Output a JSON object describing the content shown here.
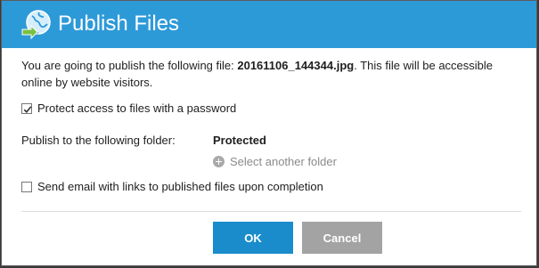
{
  "dialog": {
    "title": "Publish Files",
    "title_icon": "publish-globe-arrow-icon"
  },
  "intro": {
    "prefix": "You are going to publish the following file: ",
    "filename": "20161106_144344.jpg",
    "suffix": ". This file will be accessible online by website visitors."
  },
  "protect": {
    "label": "Protect access to files with a password",
    "checked": true
  },
  "folder": {
    "label": "Publish to the following folder:",
    "value": "Protected",
    "select_label": "Select another folder",
    "select_icon": "plus-circle-icon"
  },
  "email": {
    "label": "Send email with links to published files upon completion",
    "checked": false
  },
  "buttons": {
    "ok": "OK",
    "cancel": "Cancel"
  },
  "colors": {
    "titlebar": "#2d9ad8",
    "ok_button": "#1a8ccb",
    "cancel_button": "#a3a3a3"
  }
}
